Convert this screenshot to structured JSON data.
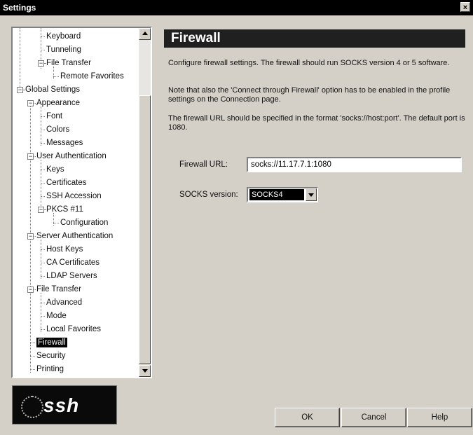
{
  "window": {
    "title": "Settings",
    "close_glyph": "×"
  },
  "tree": {
    "items": [
      {
        "label": "Keyboard",
        "name": "tree-item-keyboard"
      },
      {
        "label": "Tunneling",
        "name": "tree-item-tunneling"
      },
      {
        "label": "File Transfer",
        "name": "tree-item-profile-file-transfer"
      },
      {
        "label": "Remote Favorites",
        "name": "tree-item-remote-favorites"
      },
      {
        "label": "Global Settings",
        "name": "tree-item-global-settings"
      },
      {
        "label": "Appearance",
        "name": "tree-item-appearance"
      },
      {
        "label": "Font",
        "name": "tree-item-font"
      },
      {
        "label": "Colors",
        "name": "tree-item-colors"
      },
      {
        "label": "Messages",
        "name": "tree-item-messages"
      },
      {
        "label": "User Authentication",
        "name": "tree-item-user-authentication"
      },
      {
        "label": "Keys",
        "name": "tree-item-keys"
      },
      {
        "label": "Certificates",
        "name": "tree-item-certificates"
      },
      {
        "label": "SSH Accession",
        "name": "tree-item-ssh-accession"
      },
      {
        "label": "PKCS #11",
        "name": "tree-item-pkcs11"
      },
      {
        "label": "Configuration",
        "name": "tree-item-configuration"
      },
      {
        "label": "Server Authentication",
        "name": "tree-item-server-authentication"
      },
      {
        "label": "Host Keys",
        "name": "tree-item-host-keys"
      },
      {
        "label": "CA Certificates",
        "name": "tree-item-ca-certificates"
      },
      {
        "label": "LDAP Servers",
        "name": "tree-item-ldap-servers"
      },
      {
        "label": "File Transfer",
        "name": "tree-item-file-transfer"
      },
      {
        "label": "Advanced",
        "name": "tree-item-advanced"
      },
      {
        "label": "Mode",
        "name": "tree-item-mode"
      },
      {
        "label": "Local Favorites",
        "name": "tree-item-local-favorites"
      },
      {
        "label": "Firewall",
        "name": "tree-item-firewall"
      },
      {
        "label": "Security",
        "name": "tree-item-security"
      },
      {
        "label": "Printing",
        "name": "tree-item-printing"
      }
    ],
    "selected": "Firewall",
    "expander_glyph": "−"
  },
  "panel": {
    "heading": "Firewall",
    "description_1": "Configure firewall settings. The firewall should run SOCKS version 4 or 5 software.",
    "description_2": "Note that also the 'Connect through Firewall' option has to be enabled in the profile settings on the Connection page.",
    "description_3": "The firewall URL should be specified in the format 'socks://host:port'. The default port is 1080.",
    "firewall_url_label": "Firewall URL:",
    "firewall_url_value": "socks://11.17.7.1:1080",
    "socks_version_label": "SOCKS version:",
    "socks_version_value": "SOCKS4"
  },
  "logo": {
    "text": "ssh"
  },
  "buttons": {
    "ok": "OK",
    "cancel": "Cancel",
    "help": "Help"
  }
}
